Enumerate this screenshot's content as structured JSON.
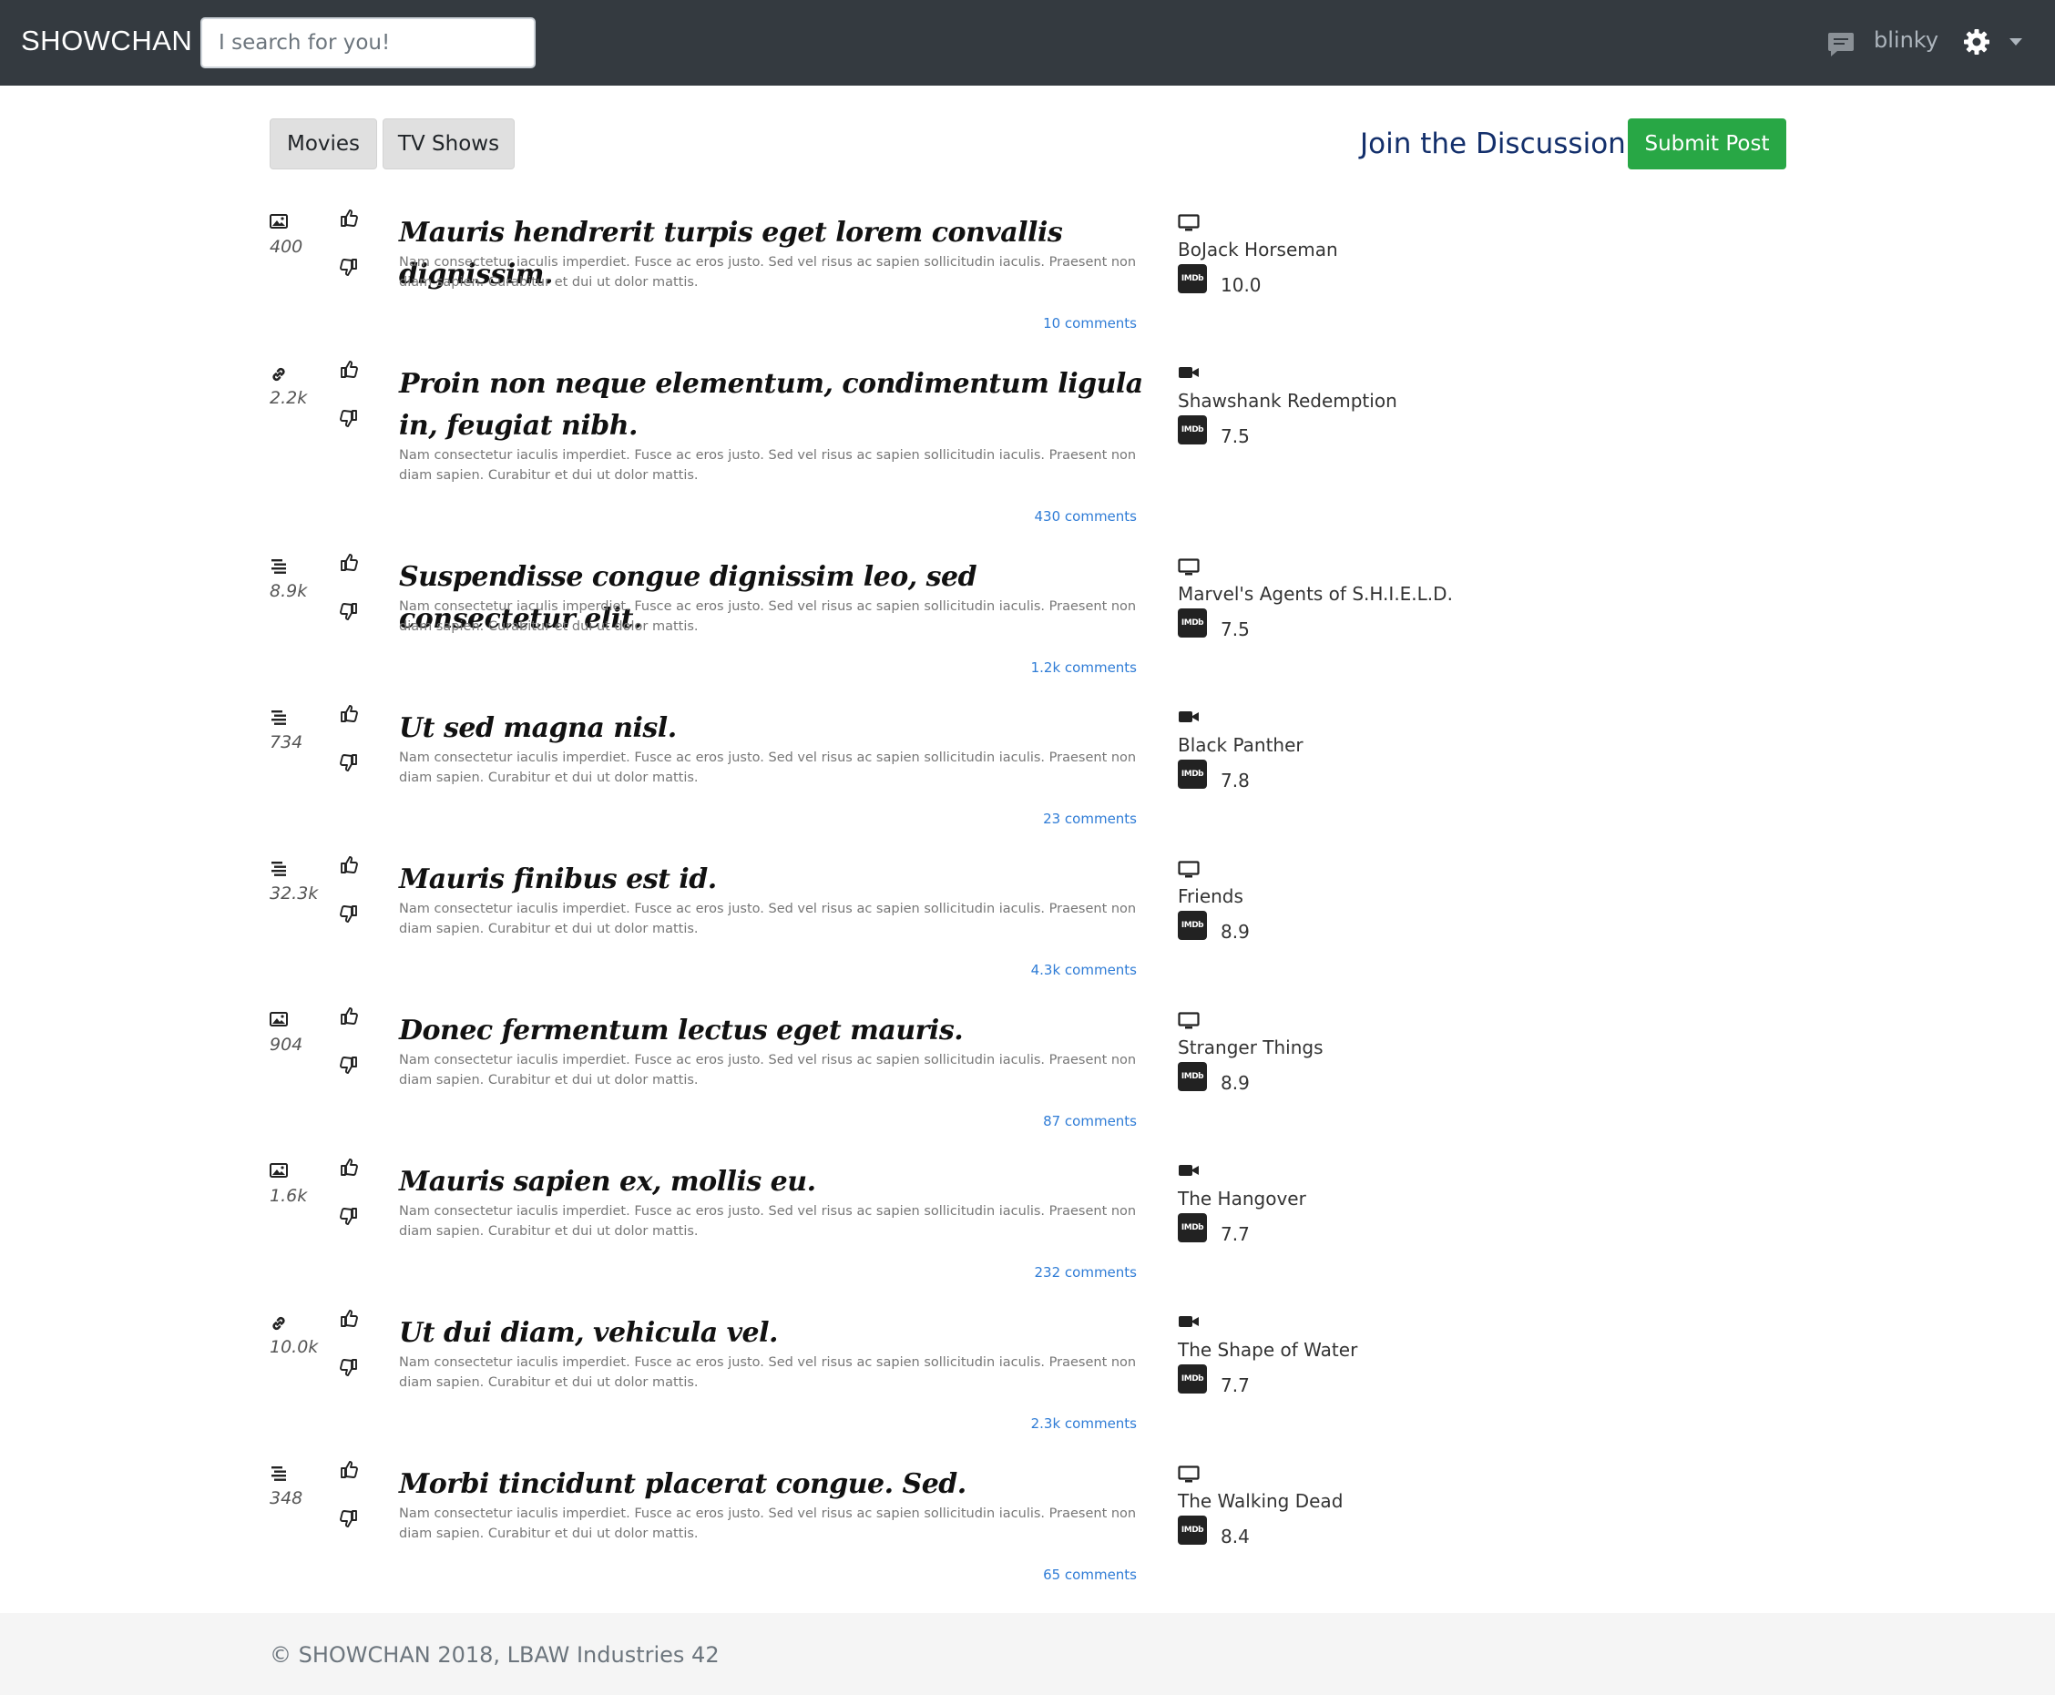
{
  "navbar": {
    "brand": "SHOWCHAN",
    "search_placeholder": "I search for you!",
    "username": "blinky",
    "icons": [
      "chat-icon",
      "gear-icon",
      "caret-down-icon"
    ]
  },
  "subheader": {
    "tabs": [
      "Movies",
      "TV Shows"
    ],
    "join_label": "Join the Discussion",
    "submit_label": "Submit Post"
  },
  "posts": [
    {
      "type": "image",
      "count": "400",
      "title": "Mauris hendrerit turpis eget lorem convallis dignissim.",
      "body": "Nam consectetur iaculis imperdiet. Fusce ac eros justo. Sed vel risus ac sapien sollicitudin iaculis. Praesent non diam sapien. Curabitur et dui ut dolor mattis.",
      "comments": "10 comments",
      "media_type": "tv",
      "media_name": "BoJack Horseman",
      "rating": "10.0"
    },
    {
      "type": "link",
      "count": "2.2k",
      "title": "Proin non neque elementum, condimentum ligula in, feugiat nibh.",
      "body": "Nam consectetur iaculis imperdiet. Fusce ac eros justo. Sed vel risus ac sapien sollicitudin iaculis. Praesent non diam sapien. Curabitur et dui ut dolor mattis.",
      "comments": "430 comments",
      "media_type": "movie",
      "media_name": "Shawshank Redemption",
      "rating": "7.5"
    },
    {
      "type": "text",
      "count": "8.9k",
      "title": "Suspendisse congue dignissim leo, sed consectetur elit.",
      "body": "Nam consectetur iaculis imperdiet. Fusce ac eros justo. Sed vel risus ac sapien sollicitudin iaculis. Praesent non diam sapien. Curabitur et dui ut dolor mattis.",
      "comments": "1.2k comments",
      "media_type": "tv",
      "media_name": "Marvel's Agents of S.H.I.E.L.D.",
      "rating": "7.5"
    },
    {
      "type": "text",
      "count": "734",
      "title": "Ut sed magna nisl.",
      "body": "Nam consectetur iaculis imperdiet. Fusce ac eros justo. Sed vel risus ac sapien sollicitudin iaculis. Praesent non diam sapien. Curabitur et dui ut dolor mattis.",
      "comments": "23 comments",
      "media_type": "movie",
      "media_name": "Black Panther",
      "rating": "7.8"
    },
    {
      "type": "text",
      "count": "32.3k",
      "title": "Mauris finibus est id.",
      "body": "Nam consectetur iaculis imperdiet. Fusce ac eros justo. Sed vel risus ac sapien sollicitudin iaculis. Praesent non diam sapien. Curabitur et dui ut dolor mattis.",
      "comments": "4.3k comments",
      "media_type": "tv",
      "media_name": "Friends",
      "rating": "8.9"
    },
    {
      "type": "image",
      "count": "904",
      "title": "Donec fermentum lectus eget mauris.",
      "body": "Nam consectetur iaculis imperdiet. Fusce ac eros justo. Sed vel risus ac sapien sollicitudin iaculis. Praesent non diam sapien. Curabitur et dui ut dolor mattis.",
      "comments": "87 comments",
      "media_type": "tv",
      "media_name": "Stranger Things",
      "rating": "8.9"
    },
    {
      "type": "image",
      "count": "1.6k",
      "title": "Mauris sapien ex, mollis eu.",
      "body": "Nam consectetur iaculis imperdiet. Fusce ac eros justo. Sed vel risus ac sapien sollicitudin iaculis. Praesent non diam sapien. Curabitur et dui ut dolor mattis.",
      "comments": "232 comments",
      "media_type": "movie",
      "media_name": "The Hangover",
      "rating": "7.7"
    },
    {
      "type": "link",
      "count": "10.0k",
      "title": "Ut dui diam, vehicula vel.",
      "body": "Nam consectetur iaculis imperdiet. Fusce ac eros justo. Sed vel risus ac sapien sollicitudin iaculis. Praesent non diam sapien. Curabitur et dui ut dolor mattis.",
      "comments": "2.3k comments",
      "media_type": "movie",
      "media_name": "The Shape of Water",
      "rating": "7.7"
    },
    {
      "type": "text",
      "count": "348",
      "title": "Morbi tincidunt placerat congue. Sed.",
      "body": "Nam consectetur iaculis imperdiet. Fusce ac eros justo. Sed vel risus ac sapien sollicitudin iaculis. Praesent non diam sapien. Curabitur et dui ut dolor mattis.",
      "comments": "65 comments",
      "media_type": "tv",
      "media_name": "The Walking Dead",
      "rating": "8.4"
    }
  ],
  "imdb_label": "IMDb",
  "footer": {
    "text": "© SHOWCHAN 2018, LBAW Industries 42"
  }
}
